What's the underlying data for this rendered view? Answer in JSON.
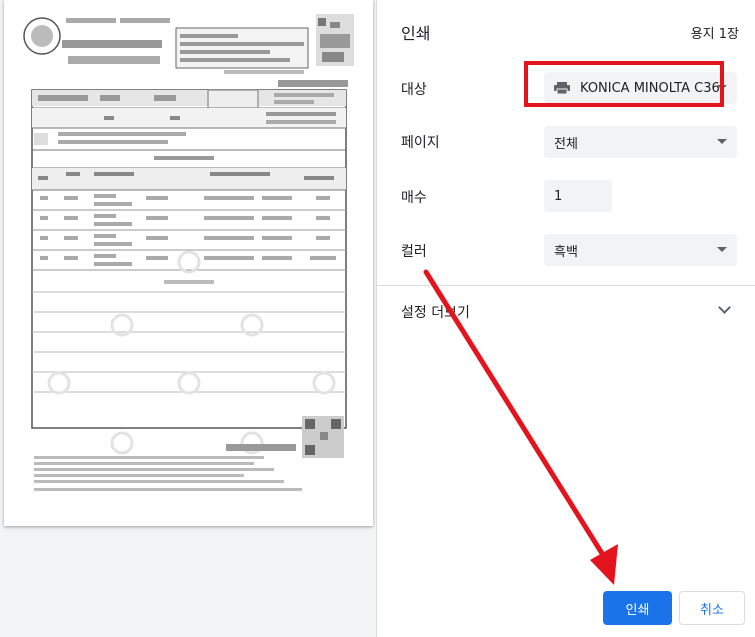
{
  "dialog": {
    "title": "인쇄",
    "sheet_count": "용지 1장"
  },
  "settings": {
    "destination": {
      "label": "대상",
      "value": "KONICA MINOLTA C36"
    },
    "pages": {
      "label": "페이지",
      "value": "전체"
    },
    "copies": {
      "label": "매수",
      "value": "1"
    },
    "color": {
      "label": "컬러",
      "value": "흑백"
    },
    "more_settings_label": "설정 더보기"
  },
  "buttons": {
    "print": "인쇄",
    "cancel": "취소"
  },
  "annotation": {
    "highlight_color": "#e3141e",
    "arrow_color": "#e3141e"
  },
  "colors": {
    "accent": "#1a73e8",
    "field_bg": "#f1f3f4"
  }
}
